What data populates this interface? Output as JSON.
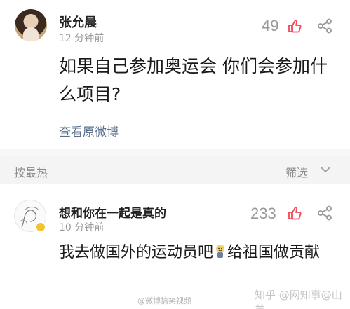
{
  "post": {
    "author": "张允晨",
    "time": "12 分钟前",
    "likes": "49",
    "question": "如果自己参加奥运会 你们会参加什么项目?",
    "view_original": "查看原微博"
  },
  "sortbar": {
    "sort_label": "按最热",
    "filter_label": "筛选"
  },
  "reply": {
    "author": "想和你在一起是真的",
    "time": "10 分钟前",
    "likes": "233",
    "answer_part1": "我去做国外的运动员吧",
    "answer_part2": "给祖国做贡献"
  },
  "watermarks": {
    "left": "@微博搞笑视频",
    "right": "知乎 @网知事@山羊"
  },
  "colors": {
    "like_red": "#f0485c",
    "link_blue": "#5a6f8c",
    "muted_gray": "#9a9a9a"
  },
  "icons": {
    "like": "thumbs-up-icon",
    "share": "share-icon",
    "filter": "chevron-down-icon",
    "emoji": "sweat-smile-emoji"
  }
}
